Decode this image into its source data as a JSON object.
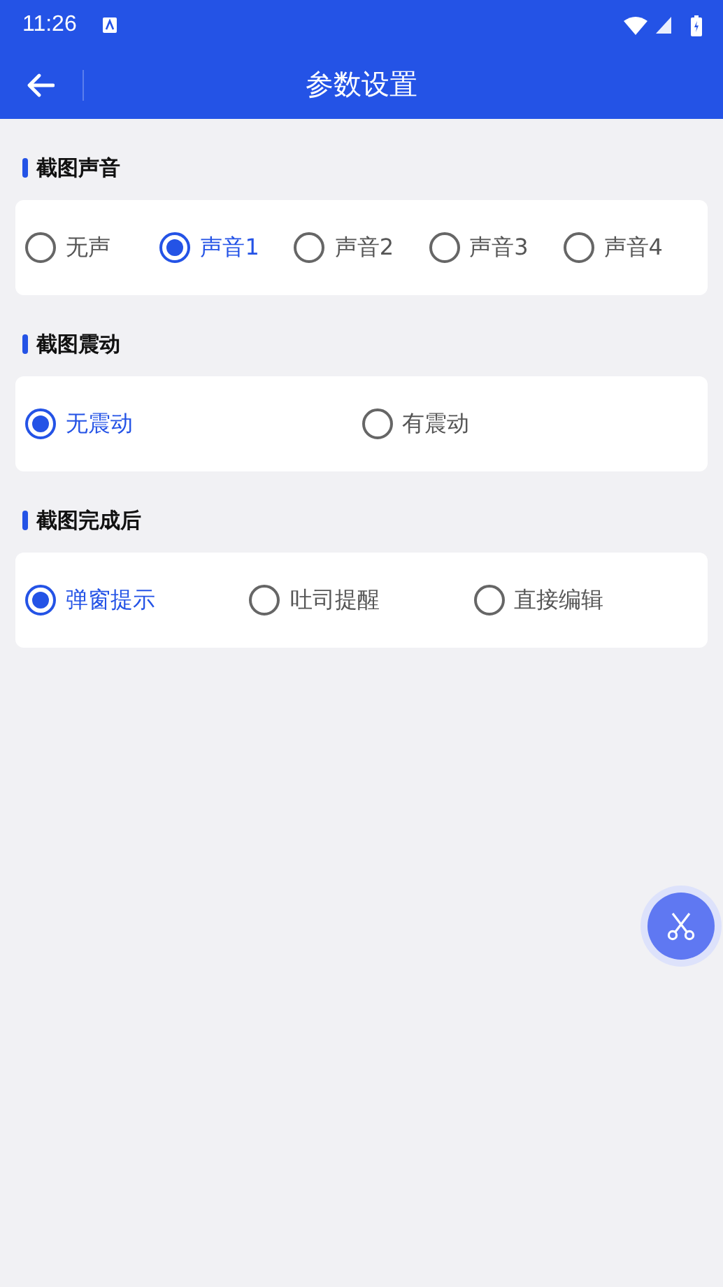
{
  "status_bar": {
    "time": "11:26"
  },
  "toolbar": {
    "title": "参数设置"
  },
  "sections": [
    {
      "title": "截图声音",
      "options": [
        {
          "label": "无声",
          "selected": false
        },
        {
          "label": "声音1",
          "selected": true
        },
        {
          "label": "声音2",
          "selected": false
        },
        {
          "label": "声音3",
          "selected": false
        },
        {
          "label": "声音4",
          "selected": false
        }
      ]
    },
    {
      "title": "截图震动",
      "options": [
        {
          "label": "无震动",
          "selected": true
        },
        {
          "label": "有震动",
          "selected": false
        }
      ]
    },
    {
      "title": "截图完成后",
      "options": [
        {
          "label": "弹窗提示",
          "selected": true
        },
        {
          "label": "吐司提醒",
          "selected": false
        },
        {
          "label": "直接编辑",
          "selected": false
        }
      ]
    }
  ]
}
